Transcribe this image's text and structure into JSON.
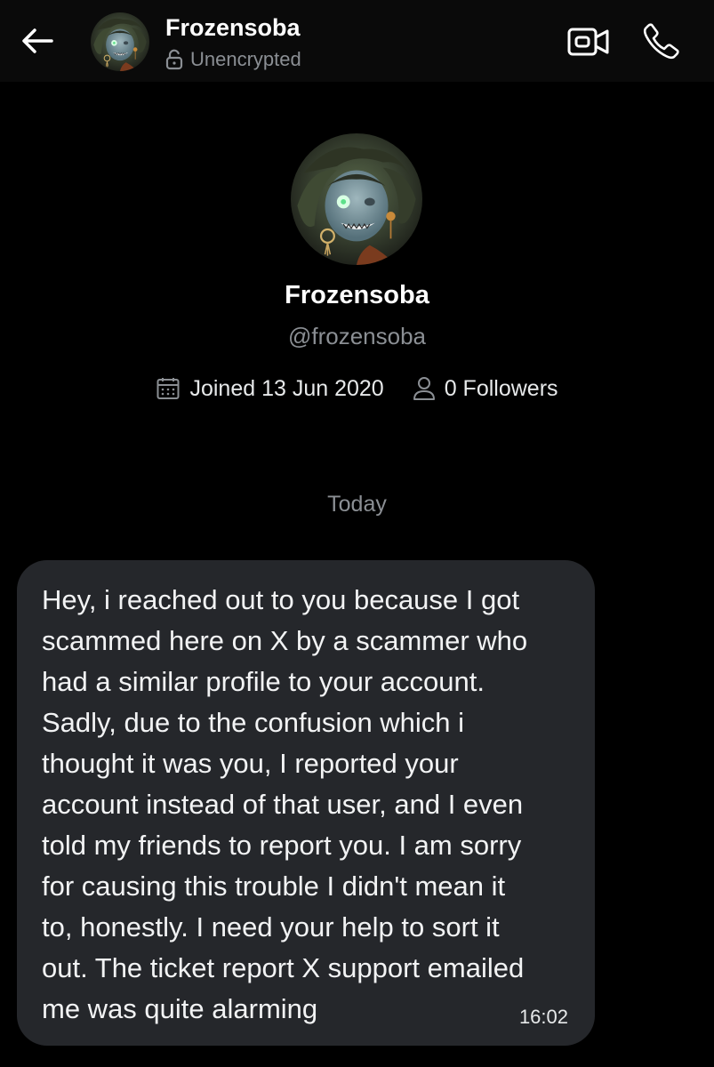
{
  "header": {
    "name": "Frozensoba",
    "status": "Unencrypted",
    "back_icon": "arrow-left-icon",
    "video_icon": "video-camera-icon",
    "phone_icon": "phone-icon"
  },
  "profile": {
    "name": "Frozensoba",
    "handle": "@frozensoba",
    "joined": "Joined 13 Jun 2020",
    "followers": "0 Followers"
  },
  "conversation": {
    "date_separator": "Today",
    "messages": [
      {
        "text": "Hey, i reached out to you because I got\nscammed here on X by a scammer who\nhad a similar profile to your account.\nSadly, due to the confusion which i\nthought it was you, I reported your\naccount instead of that user, and I even\ntold my friends to report you. I am sorry\nfor causing this trouble I didn't mean it\nto, honestly. I need your help to sort it\nout. The ticket report X support emailed\nme was quite alarming",
        "time": "16:02"
      }
    ]
  },
  "colors": {
    "background": "#000000",
    "topbar": "#0a0a0a",
    "bubble": "#25272b",
    "secondary_text": "#8b8f94",
    "primary_text": "#e7e9ea"
  }
}
